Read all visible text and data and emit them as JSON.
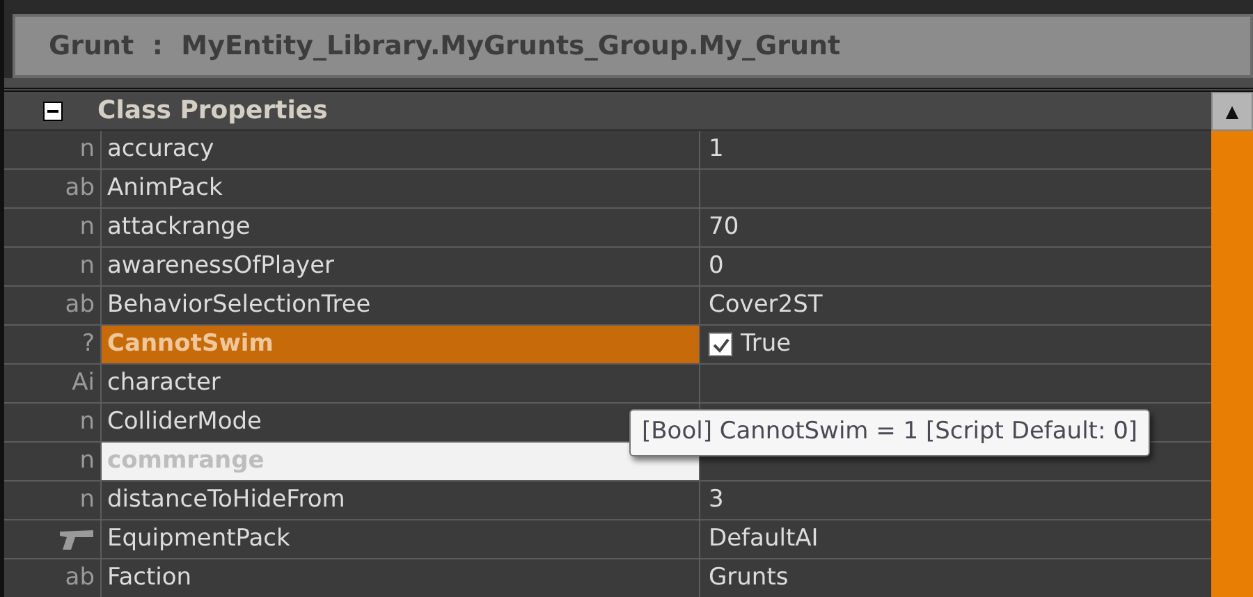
{
  "header": {
    "title": "Grunt  :  MyEntity_Library.MyGrunts_Group.My_Grunt"
  },
  "section": {
    "label": "Class Properties",
    "expanded": true
  },
  "rows": [
    {
      "type_glyph": "n",
      "kind": "glyph",
      "name": "accuracy",
      "value": "1",
      "selected": false,
      "hovered": false
    },
    {
      "type_glyph": "ab",
      "kind": "glyph",
      "name": "AnimPack",
      "selected": false,
      "hovered": false
    },
    {
      "type_glyph": "n",
      "kind": "glyph",
      "name": "attackrange",
      "value": "70",
      "selected": false,
      "hovered": false
    },
    {
      "type_glyph": "n",
      "kind": "glyph",
      "name": "awarenessOfPlayer",
      "value": "0",
      "selected": false,
      "hovered": false
    },
    {
      "type_glyph": "ab",
      "kind": "glyph",
      "name": "BehaviorSelectionTree",
      "value": "Cover2ST",
      "selected": false,
      "hovered": false
    },
    {
      "type_glyph": "?",
      "kind": "glyph",
      "name": "CannotSwim",
      "value": "True",
      "checked": true,
      "selected": true,
      "hovered": false
    },
    {
      "type_glyph": "Ai",
      "kind": "glyph",
      "name": "character",
      "selected": false,
      "hovered": false
    },
    {
      "type_glyph": "n",
      "kind": "glyph",
      "name": "ColliderMode",
      "selected": false,
      "hovered": false
    },
    {
      "type_glyph": "n",
      "kind": "glyph",
      "name": "commrange",
      "selected": false,
      "hovered": true
    },
    {
      "type_glyph": "n",
      "kind": "glyph",
      "name": "distanceToHideFrom",
      "value": "3",
      "selected": false,
      "hovered": false
    },
    {
      "kind": "gun",
      "name": "EquipmentPack",
      "value": "DefaultAI",
      "selected": false,
      "hovered": false
    },
    {
      "type_glyph": "ab",
      "kind": "glyph",
      "name": "Faction",
      "value": "Grunts",
      "selected": false,
      "hovered": false
    }
  ],
  "tooltip": {
    "text": "[Bool] CannotSwim = 1 [Script Default: 0]"
  },
  "scrollbar": {
    "up_glyph": "▲"
  }
}
